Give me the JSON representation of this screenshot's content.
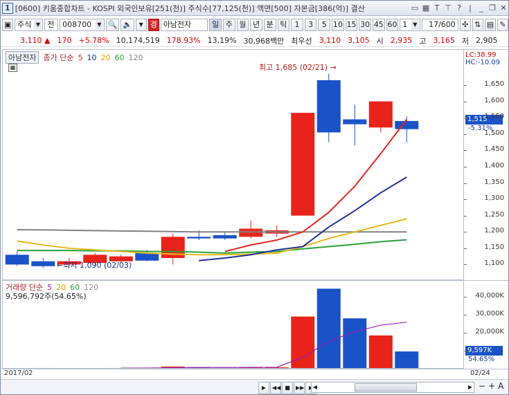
{
  "title": {
    "number": "1",
    "text": "[0600] 키움종합차트 - KOSPI 외국인보유[251(천)] 주식수[77,125(천)] 액면[500] 자본금[386(억)] 결산",
    "icons": [
      "tile-icon",
      "grid-icon",
      "font-icon",
      "pin-icon",
      "help-icon"
    ]
  },
  "toolbar": {
    "market": "주식",
    "mode": "전",
    "code": "008700",
    "name_tag": "경",
    "stock_name": "아남전자",
    "periods": [
      "일",
      "주",
      "월",
      "년",
      "분",
      "틱"
    ],
    "minutes": [
      "1",
      "3",
      "5",
      "10",
      "15",
      "30",
      "45",
      "60"
    ],
    "count_select": "1",
    "page": "17/600"
  },
  "info": {
    "price": "3,110",
    "change": "170",
    "change_pct": "+5.78%",
    "volume": "10,174,519",
    "vol_ratio": "178.93%",
    "turnover": "13.19%",
    "amount": "30,968백만",
    "quote_label": "최우선",
    "bid": "3,110",
    "ask": "3,105",
    "open_label": "시",
    "open": "2,935",
    "high_label": "고",
    "high": "3,165",
    "low_label": "저",
    "low": "2,905"
  },
  "price_legend": {
    "stock": "아남전자",
    "label": "종가 단순",
    "ma": [
      "5",
      "10",
      "20",
      "60",
      "120"
    ]
  },
  "annotations": {
    "high": "최고 1,685 (02/21)",
    "low": "최저 1,090 (02/03)"
  },
  "axis": {
    "lc": "LC:38.99",
    "hc": "HC:-10.09",
    "current": "1,515",
    "current_pct": "-5.31%",
    "vol_current": "9,597K",
    "vol_pct": "54.65%"
  },
  "volume_legend": {
    "label": "거래량 단순",
    "ma": [
      "5",
      "20",
      "60",
      "120"
    ],
    "value": "9,596,792주(54.65%)"
  },
  "dates": {
    "start": "2017/02",
    "end": "02/24"
  },
  "colors": {
    "up": "#e8231a",
    "down": "#1a52c8",
    "ma5": "#e8231a",
    "ma10": "#1c2f9a",
    "ma20": "#e6b81c",
    "ma60": "#28a03a",
    "ma120": "#808080"
  },
  "chart_data": {
    "type": "candlestick",
    "price_axis": {
      "ticks": [
        1100,
        1150,
        1200,
        1250,
        1300,
        1350,
        1400,
        1450,
        1500,
        1550,
        1600,
        1650
      ],
      "ylim": [
        1050,
        1720
      ]
    },
    "candles": [
      {
        "o": 1130,
        "h": 1140,
        "l": 1095,
        "c": 1100
      },
      {
        "o": 1110,
        "h": 1120,
        "l": 1090,
        "c": 1095
      },
      {
        "o": 1100,
        "h": 1120,
        "l": 1095,
        "c": 1110
      },
      {
        "o": 1105,
        "h": 1135,
        "l": 1100,
        "c": 1130
      },
      {
        "o": 1110,
        "h": 1130,
        "l": 1105,
        "c": 1125
      },
      {
        "o": 1135,
        "h": 1145,
        "l": 1110,
        "c": 1112
      },
      {
        "o": 1120,
        "h": 1195,
        "l": 1100,
        "c": 1185
      },
      {
        "o": 1185,
        "h": 1205,
        "l": 1175,
        "c": 1180
      },
      {
        "o": 1190,
        "h": 1200,
        "l": 1175,
        "c": 1180
      },
      {
        "o": 1185,
        "h": 1235,
        "l": 1180,
        "c": 1210
      },
      {
        "o": 1195,
        "h": 1220,
        "l": 1185,
        "c": 1205
      },
      {
        "o": 1250,
        "h": 1565,
        "l": 1250,
        "c": 1565
      },
      {
        "o": 1665,
        "h": 1685,
        "l": 1475,
        "c": 1505
      },
      {
        "o": 1545,
        "h": 1590,
        "l": 1465,
        "c": 1530
      },
      {
        "o": 1520,
        "h": 1600,
        "l": 1505,
        "c": 1600
      },
      {
        "o": 1540,
        "h": 1555,
        "l": 1475,
        "c": 1515
      }
    ],
    "ma5": [
      null,
      null,
      null,
      null,
      null,
      null,
      null,
      null,
      1140,
      1160,
      1175,
      1200,
      1260,
      1340,
      1440,
      1545
    ],
    "ma10": [
      null,
      null,
      null,
      null,
      null,
      null,
      null,
      1112,
      1120,
      1130,
      1145,
      1155,
      1215,
      1265,
      1320,
      1368
    ],
    "ma20": [
      1172,
      1160,
      1150,
      1145,
      1140,
      1135,
      1132,
      1130,
      1130,
      1132,
      1135,
      1155,
      1180,
      1200,
      1220,
      1240
    ],
    "ma60": [
      1143,
      1143,
      1143,
      1142,
      1142,
      1140,
      1140,
      1138,
      1135,
      1138,
      1140,
      1148,
      1155,
      1162,
      1170,
      1176
    ],
    "ma120": [
      1207,
      1206,
      1205,
      1204,
      1203,
      1202,
      1201,
      1200,
      1200,
      1200,
      1200,
      1200,
      1200,
      1200,
      1200,
      1200
    ],
    "volume_axis": {
      "ticks": [
        10000,
        20000,
        30000,
        40000
      ],
      "labels": [
        "",
        "20,000K",
        "30,000K",
        "40,000K"
      ],
      "ylim": [
        0,
        45000
      ]
    },
    "volume": [
      300,
      400,
      350,
      300,
      400,
      500,
      1200,
      900,
      500,
      700,
      800,
      29000,
      44500,
      28000,
      18500,
      9597
    ],
    "volume_ma5": [
      null,
      null,
      null,
      null,
      350,
      390,
      550,
      660,
      700,
      760,
      820,
      6300,
      15200,
      20600,
      24200,
      25900
    ]
  }
}
